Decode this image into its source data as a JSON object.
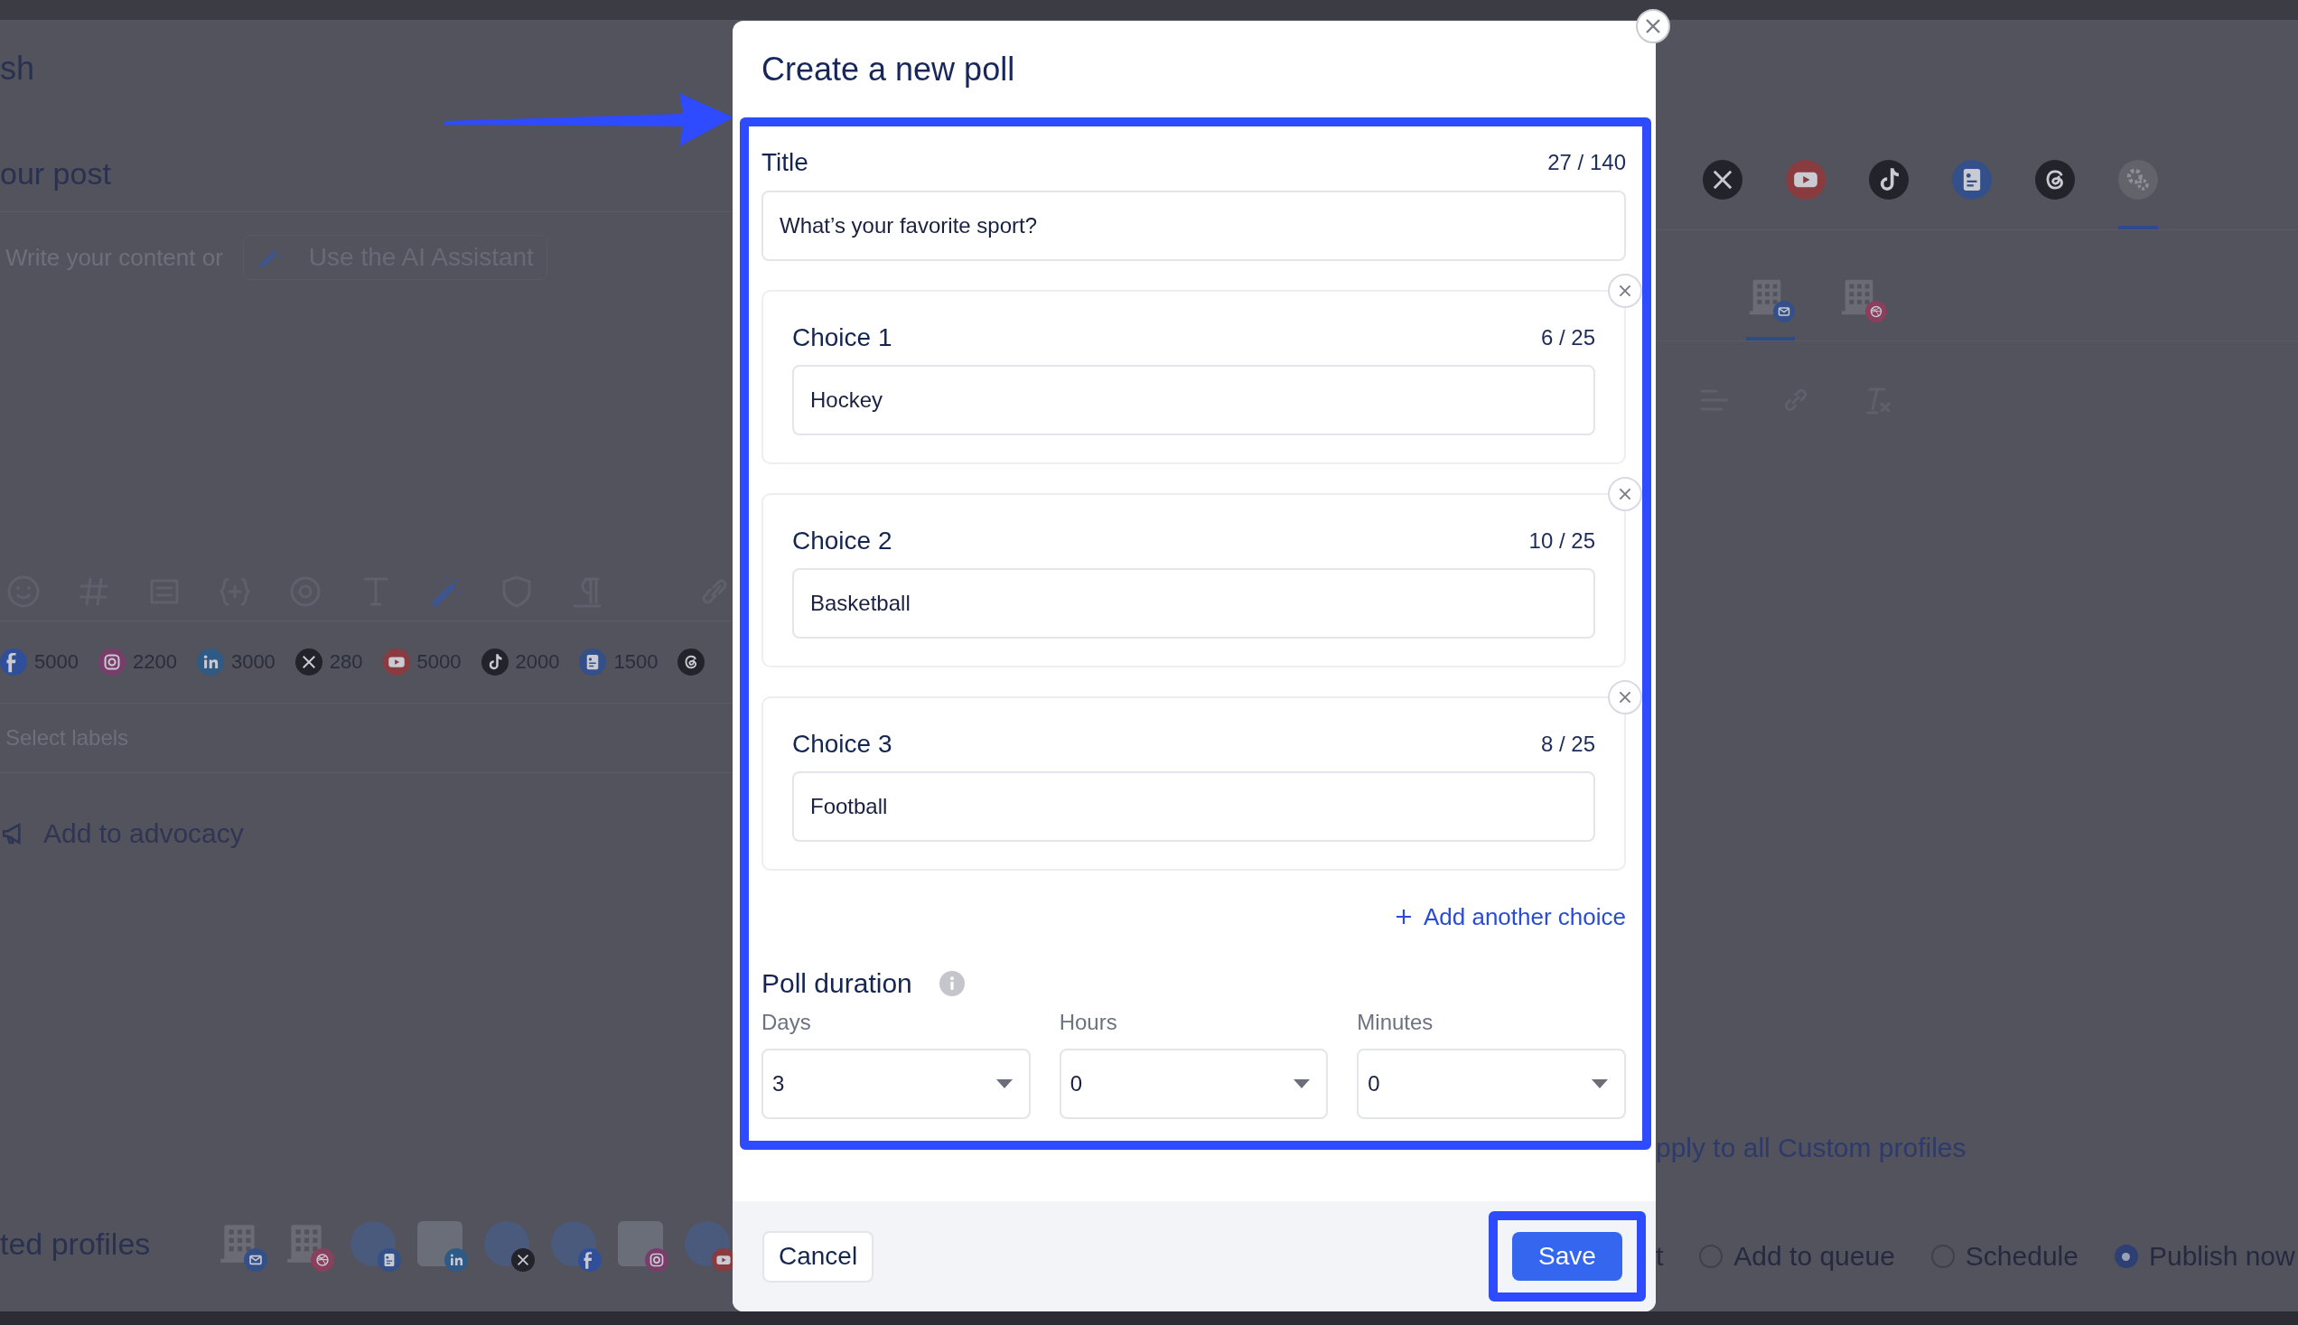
{
  "background": {
    "heading": "sh",
    "post_title": "our post",
    "editor": {
      "prompt": "Write your content or",
      "ai_button": "Use the AI Assistant"
    },
    "char_limits": [
      {
        "kind": "facebook",
        "count": "5000"
      },
      {
        "kind": "instagram",
        "count": "2200"
      },
      {
        "kind": "linkedin",
        "count": "3000"
      },
      {
        "kind": "x",
        "count": "280"
      },
      {
        "kind": "youtube",
        "count": "5000"
      },
      {
        "kind": "tiktok",
        "count": "2000"
      },
      {
        "kind": "business",
        "count": "1500"
      },
      {
        "kind": "threads"
      }
    ],
    "labels_placeholder": "Select labels",
    "advocacy": "Add to advocacy",
    "profiles_title": "ted profiles",
    "profiles": [
      {
        "kind": "building",
        "badge": {
          "kind": "email"
        }
      },
      {
        "kind": "building",
        "badge": {
          "kind": "dribbble"
        }
      },
      {
        "kind": "photo",
        "badge": {
          "kind": "business"
        }
      },
      {
        "kind": "photo_square",
        "badge": {
          "kind": "linkedin"
        }
      },
      {
        "kind": "photo",
        "badge": {
          "kind": "x"
        }
      },
      {
        "kind": "photo",
        "badge": {
          "kind": "facebook"
        }
      },
      {
        "kind": "photo_square",
        "badge": {
          "kind": "instagram"
        }
      },
      {
        "kind": "photo",
        "badge": {
          "kind": "youtube"
        }
      }
    ],
    "network_tabs": [
      {
        "kind": "x",
        "selected": false
      },
      {
        "kind": "youtube",
        "selected": false
      },
      {
        "kind": "tiktok",
        "selected": false
      },
      {
        "kind": "business",
        "selected": false
      },
      {
        "kind": "threads",
        "selected": false
      },
      {
        "kind": "settings",
        "selected": true
      }
    ],
    "profile_tabs": [
      {
        "kind": "email",
        "selected": true
      },
      {
        "kind": "dribbble",
        "selected": false
      }
    ],
    "apply_link": "pply to all Custom profiles",
    "publish_cut": "t",
    "publish_options": [
      {
        "label": "Add to queue",
        "selected": false
      },
      {
        "label": "Schedule",
        "selected": false
      },
      {
        "label": "Publish now",
        "selected": true
      }
    ]
  },
  "modal": {
    "title": "Create a new poll",
    "title_field": {
      "label": "Title",
      "counter": "27 / 140",
      "value": "What’s your favorite sport?"
    },
    "choices": [
      {
        "label": "Choice 1",
        "counter": "6 / 25",
        "value": "Hockey"
      },
      {
        "label": "Choice 2",
        "counter": "10 / 25",
        "value": "Basketball"
      },
      {
        "label": "Choice 3",
        "counter": "8 / 25",
        "value": "Football"
      }
    ],
    "add_choice": "Add another choice",
    "duration": {
      "label": "Poll duration",
      "fields": [
        {
          "label": "Days",
          "value": "3"
        },
        {
          "label": "Hours",
          "value": "0"
        },
        {
          "label": "Minutes",
          "value": "0"
        }
      ]
    },
    "cancel": "Cancel",
    "save": "Save"
  }
}
